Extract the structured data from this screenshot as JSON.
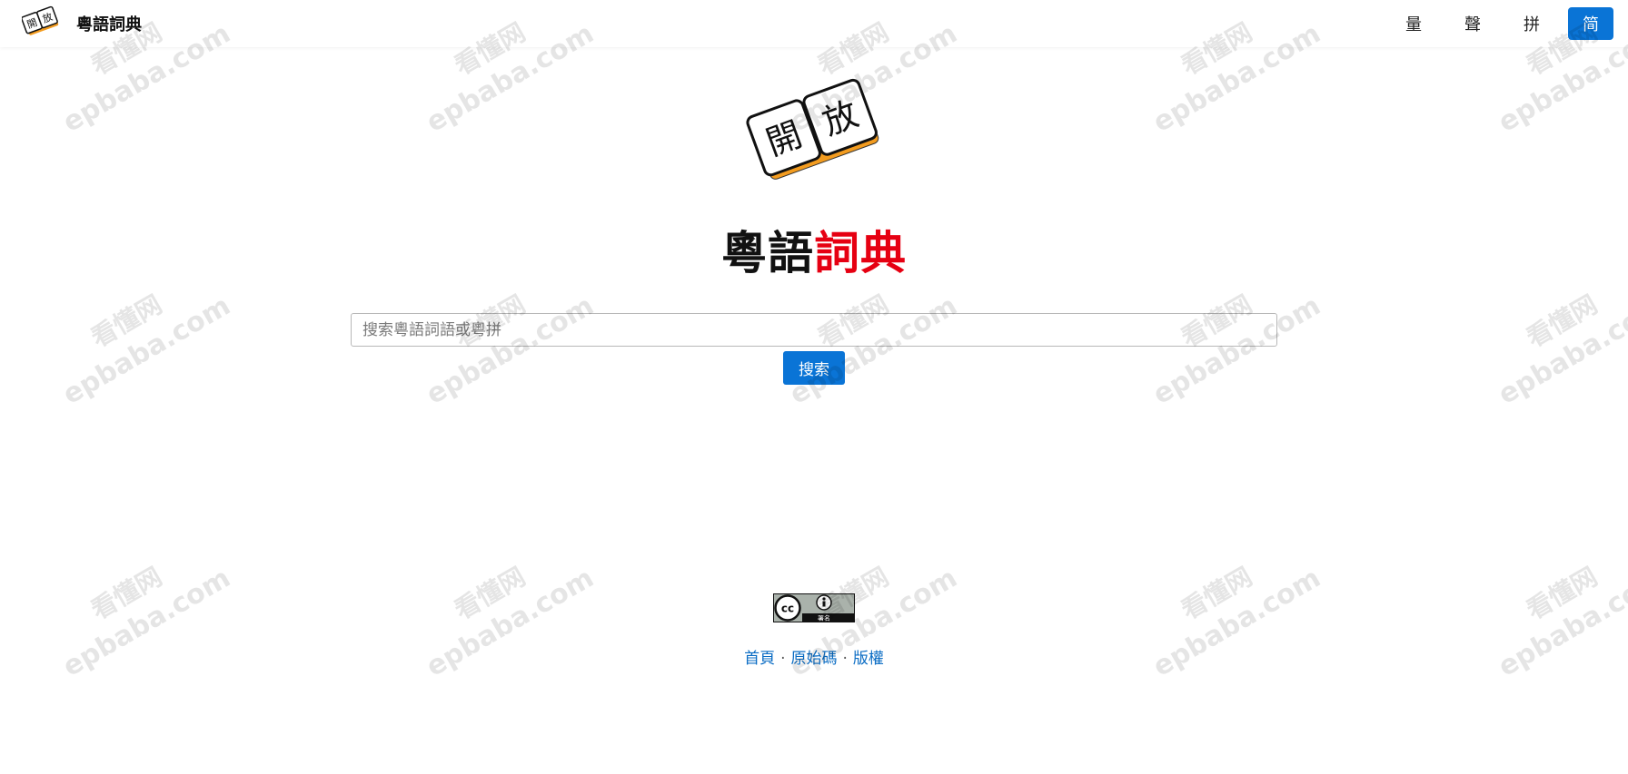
{
  "header": {
    "brand_logo_chars": [
      "開",
      "放"
    ],
    "brand_title": "粵語詞典",
    "nav_buttons": [
      {
        "label": "量",
        "active": false
      },
      {
        "label": "聲",
        "active": false
      },
      {
        "label": "拼",
        "active": false
      },
      {
        "label": "简",
        "active": true
      }
    ]
  },
  "hero": {
    "logo_chars": [
      "開",
      "放"
    ],
    "title_part1": "粵語",
    "title_part2": "詞典"
  },
  "search": {
    "placeholder": "搜索粵語詞語或粵拼",
    "value": "",
    "button_label": "搜索"
  },
  "license_badge": {
    "icon": "cc-by-icon",
    "label": "署名"
  },
  "footer": {
    "links": [
      "首頁",
      "原始碼",
      "版權"
    ],
    "separator": "·"
  },
  "watermark": {
    "line1": "看懂网",
    "line2": "epbaba.com"
  },
  "colors": {
    "accent": "#0a74d6",
    "title_red": "#e60012",
    "logo_orange": "#f39c1f"
  }
}
